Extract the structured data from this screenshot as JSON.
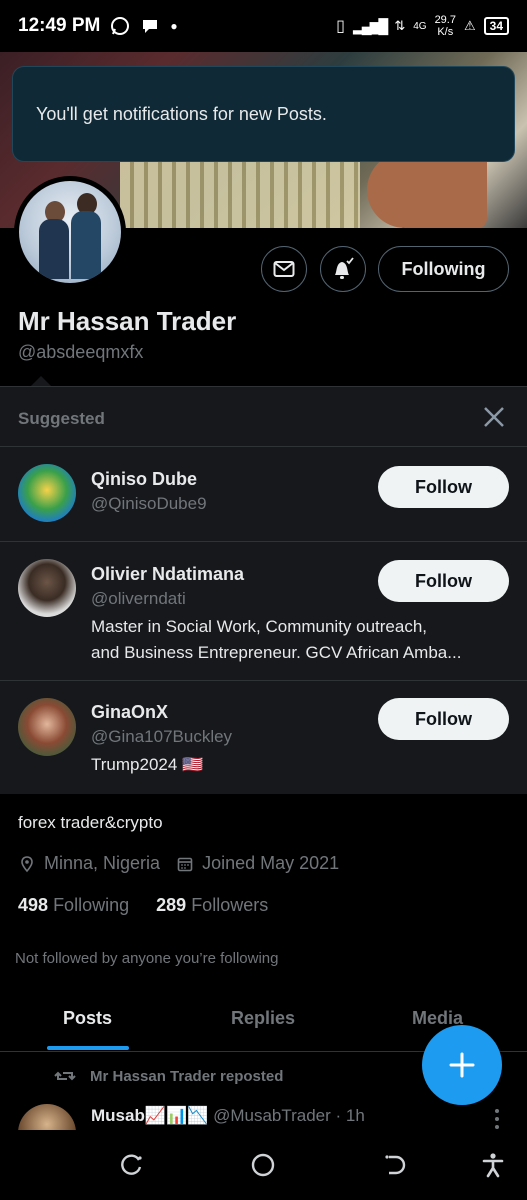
{
  "status_bar": {
    "time": "12:49 PM",
    "net_speed": "29.7",
    "net_unit": "K/s",
    "signal": "4G",
    "battery": "34"
  },
  "toast": {
    "message": "You'll get notifications for new Posts."
  },
  "profile": {
    "name": "Mr Hassan Trader",
    "handle": "@absdeeqmxfx",
    "following_button": "Following",
    "bio": "forex trader&crypto",
    "location": "Minna, Nigeria",
    "joined": "Joined May 2021",
    "following_count": "498",
    "following_label": "Following",
    "followers_count": "289",
    "followers_label": "Followers",
    "not_followed": "Not followed by anyone you’re following"
  },
  "suggested": {
    "title": "Suggested",
    "items": [
      {
        "name": "Qiniso Dube",
        "handle": "@QinisoDube9",
        "bio1": "",
        "bio2": "",
        "button": "Follow"
      },
      {
        "name": "Olivier Ndatimana",
        "handle": "@oliverndati",
        "bio1": "Master in Social Work, Community outreach,",
        "bio2": "and Business Entrepreneur. GCV African  Amba...",
        "button": "Follow"
      },
      {
        "name": "GinaOnX",
        "handle": "@Gina107Buckley",
        "bio1": "Trump2024 🇺🇸",
        "bio2": "",
        "button": "Follow"
      }
    ]
  },
  "tabs": [
    {
      "label": "Posts"
    },
    {
      "label": "Replies"
    },
    {
      "label": "Media"
    }
  ],
  "post": {
    "repost_text": "Mr Hassan Trader reposted",
    "author": "Musab📈📊📉",
    "author_handle": "@MusabTrader · 1h"
  },
  "colors": {
    "accent": "#1d9bf0",
    "background": "#000000",
    "panel": "#16181c",
    "muted": "#71767b"
  }
}
